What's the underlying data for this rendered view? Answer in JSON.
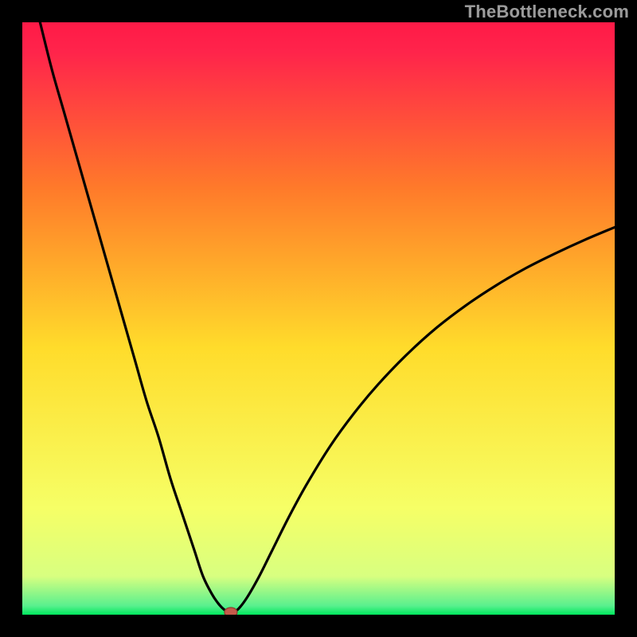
{
  "watermark": "TheBottleneck.com",
  "colors": {
    "background": "#000000",
    "gradient_top": "#ff1a47",
    "gradient_mid_upper": "#ff7a2a",
    "gradient_mid": "#ffdc2b",
    "gradient_lower": "#f6ff66",
    "gradient_bottom": "#00e85e",
    "curve": "#000000",
    "marker_fill": "#c45a4a",
    "marker_stroke": "#8e3c30"
  },
  "chart_data": {
    "type": "line",
    "title": "",
    "xlabel": "",
    "ylabel": "",
    "xlim": [
      0,
      100
    ],
    "ylim": [
      0,
      100
    ],
    "series": [
      {
        "name": "bottleneck-curve-left",
        "x": [
          3,
          5,
          7,
          9,
          11,
          13,
          15,
          17,
          19,
          21,
          23,
          25,
          27,
          29,
          30.5,
          32,
          33,
          33.7,
          34.3,
          34.8
        ],
        "values": [
          100,
          92,
          85,
          78,
          71,
          64,
          57,
          50,
          43,
          36,
          30,
          23,
          17,
          11,
          6.5,
          3.5,
          2.0,
          1.2,
          0.7,
          0.45
        ]
      },
      {
        "name": "bottleneck-curve-right",
        "x": [
          35.6,
          36.5,
          38,
          40,
          42,
          45,
          48,
          52,
          56,
          60,
          65,
          70,
          75,
          80,
          85,
          90,
          95,
          100
        ],
        "values": [
          0.45,
          1.0,
          3.0,
          6.5,
          10.5,
          16.5,
          22.0,
          28.5,
          34.0,
          38.8,
          44.0,
          48.5,
          52.3,
          55.6,
          58.5,
          61.0,
          63.3,
          65.4
        ]
      }
    ],
    "marker": {
      "x": 35.2,
      "y": 0.4
    },
    "gradient_stops": [
      {
        "pos": 0.0,
        "color": "#ff1a47"
      },
      {
        "pos": 0.05,
        "color": "#ff244b"
      },
      {
        "pos": 0.28,
        "color": "#ff7a2a"
      },
      {
        "pos": 0.55,
        "color": "#ffdc2b"
      },
      {
        "pos": 0.82,
        "color": "#f6ff66"
      },
      {
        "pos": 0.935,
        "color": "#d8ff80"
      },
      {
        "pos": 0.985,
        "color": "#59f08e"
      },
      {
        "pos": 1.0,
        "color": "#00e85e"
      }
    ]
  }
}
